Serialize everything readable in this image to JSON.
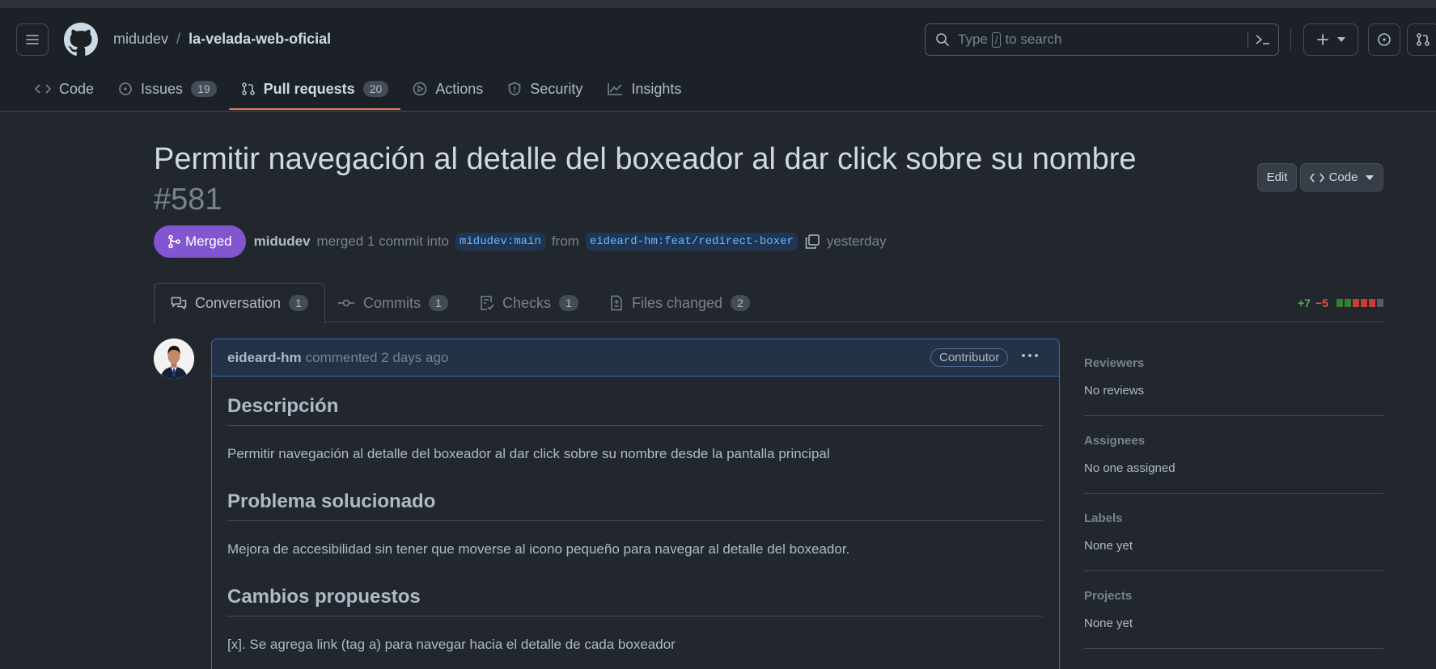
{
  "header": {
    "owner": "midudev",
    "separator": "/",
    "repo": "la-velada-web-oficial",
    "search": {
      "prefix": "Type",
      "key": "/",
      "suffix": "to search"
    }
  },
  "nav": [
    {
      "label": "Code",
      "icon": "code-icon"
    },
    {
      "label": "Issues",
      "count": "19",
      "icon": "issue-icon"
    },
    {
      "label": "Pull requests",
      "count": "20",
      "icon": "pull-request-icon",
      "active": true
    },
    {
      "label": "Actions",
      "icon": "play-icon"
    },
    {
      "label": "Security",
      "icon": "shield-icon"
    },
    {
      "label": "Insights",
      "icon": "graph-icon"
    }
  ],
  "pr": {
    "title": "Permitir navegación al detalle del boxeador al dar click sobre su nombre",
    "number": "#581",
    "edit_label": "Edit",
    "code_label": "Code",
    "state": "Merged",
    "author": "midudev",
    "action": "merged 1 commit into",
    "base_branch": "midudev:main",
    "from": "from",
    "head_branch": "eideard-hm:feat/redirect-boxer",
    "when": "yesterday"
  },
  "tabs": [
    {
      "label": "Conversation",
      "count": "1",
      "icon": "comment-discussion-icon"
    },
    {
      "label": "Commits",
      "count": "1",
      "icon": "commit-icon"
    },
    {
      "label": "Checks",
      "count": "1",
      "icon": "checklist-icon"
    },
    {
      "label": "Files changed",
      "count": "2",
      "icon": "file-diff-icon"
    }
  ],
  "diffstat": {
    "additions": "+7",
    "deletions": "−5",
    "blocks": [
      "#347d39",
      "#347d39",
      "#c93c37",
      "#c93c37",
      "#c93c37",
      "#545d68"
    ]
  },
  "comment": {
    "author": "eideard-hm",
    "meta": "commented 2 days ago",
    "badge": "Contributor",
    "sections": [
      {
        "heading": "Descripción",
        "text": "Permitir navegación al detalle del boxeador al dar click sobre su nombre desde la pantalla principal"
      },
      {
        "heading": "Problema solucionado",
        "text": "Mejora de accesibilidad sin tener que moverse al icono pequeño para navegar al detalle del boxeador."
      },
      {
        "heading": "Cambios propuestos",
        "text": "[x]. Se agrega link (tag a) para navegar hacia el detalle de cada boxeador"
      }
    ]
  },
  "sidebar": [
    {
      "label": "Reviewers",
      "value": "No reviews"
    },
    {
      "label": "Assignees",
      "value": "No one assigned"
    },
    {
      "label": "Labels",
      "value": "None yet"
    },
    {
      "label": "Projects",
      "value": "None yet"
    }
  ],
  "colors": {
    "accent_underline": "#ec775c",
    "merged": "#8256d0",
    "link": "#6cb6ff"
  }
}
